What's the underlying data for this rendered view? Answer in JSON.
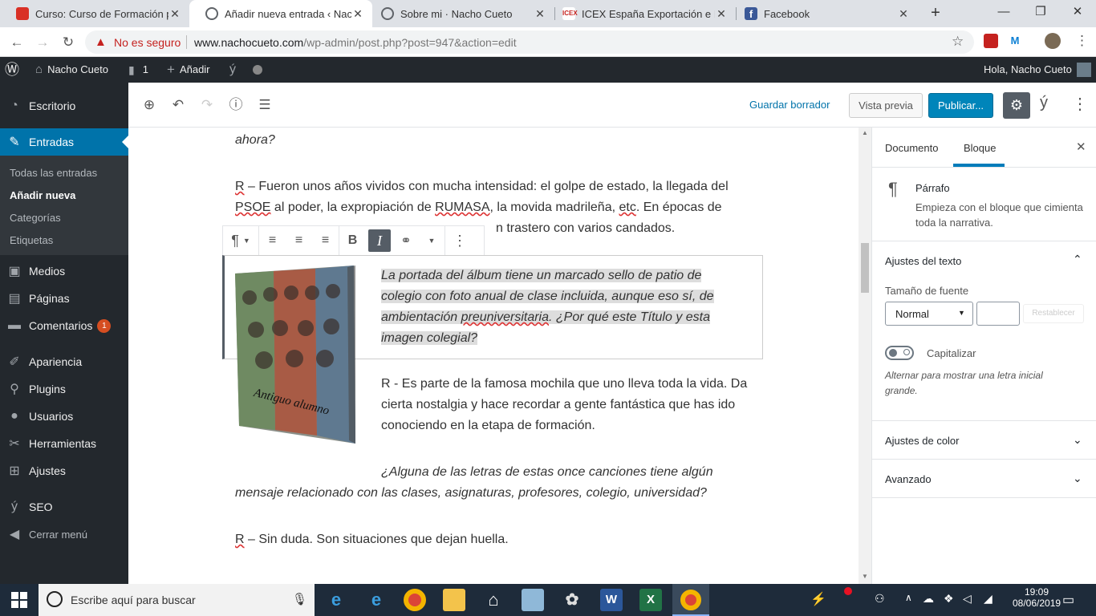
{
  "browser": {
    "tabs": [
      {
        "title": "Curso: Curso de Formación par",
        "favicon_color": "#d93025"
      },
      {
        "title": "Añadir nueva entrada ‹ Nacho",
        "favicon_color": "#5f6368"
      },
      {
        "title": "Sobre mi · Nacho Cueto",
        "favicon_color": "#5f6368"
      },
      {
        "title": "ICEX España Exportación e Inv",
        "favicon_color": "#c5221f"
      },
      {
        "title": "Facebook",
        "favicon_color": "#3b5998"
      }
    ],
    "security_label": "No es seguro",
    "url_host": "www.nachocueto.com",
    "url_path": "/wp-admin/post.php?post=947&action=edit"
  },
  "admin_bar": {
    "site_name": "Nacho Cueto",
    "comments_count": "1",
    "new_label": "Añadir",
    "greeting": "Hola, Nacho Cueto"
  },
  "sidebar": {
    "items": [
      {
        "label": "Escritorio",
        "icon": "dashboard-icon"
      },
      {
        "label": "Entradas",
        "icon": "pin-icon"
      },
      {
        "label": "Medios",
        "icon": "media-icon"
      },
      {
        "label": "Páginas",
        "icon": "pages-icon"
      },
      {
        "label": "Comentarios",
        "icon": "comments-icon",
        "badge": "1"
      },
      {
        "label": "Apariencia",
        "icon": "brush-icon"
      },
      {
        "label": "Plugins",
        "icon": "plugin-icon"
      },
      {
        "label": "Usuarios",
        "icon": "users-icon"
      },
      {
        "label": "Herramientas",
        "icon": "tools-icon"
      },
      {
        "label": "Ajustes",
        "icon": "settings-icon"
      },
      {
        "label": "SEO",
        "icon": "yoast-icon"
      },
      {
        "label": "Cerrar menú",
        "icon": "collapse-icon"
      }
    ],
    "submenu": [
      "Todas las entradas",
      "Añadir nueva",
      "Categorías",
      "Etiquetas"
    ]
  },
  "editor": {
    "save_draft": "Guardar borrador",
    "preview": "Vista previa",
    "publish": "Publicar..."
  },
  "content": {
    "p0": "ahora?",
    "p1_line1_a": "R",
    "p1_line1_b": " – Fueron unos años vividos con mucha intensidad: el golpe de estado, la llegada del",
    "p1_line2_a": "PSOE",
    "p1_line2_b": " al poder, la expropiación de ",
    "p1_line2_c": "RUMASA",
    "p1_line2_d": ", la movida madrileña, ",
    "p1_line2_e": "etc",
    "p1_line2_f": ". En épocas de",
    "p1_line3": "n trastero con varios candados.",
    "selected_line1": "La portada del álbum tiene un marcado sello de patio de",
    "selected_line2": "colegio  con foto anual de clase incluida, aunque eso sí, de",
    "selected_line3_a": "ambientación ",
    "selected_line3_b": "preuniversitaria",
    "selected_line3_c": ". ¿Por qué este Título y esta",
    "selected_line4": "imagen colegial?",
    "p3_line1": "R - Es parte de la famosa mochila que uno lleva toda la vida. Da",
    "p3_line2": "cierta nostalgia y hace recordar a gente fantástica que has ido",
    "p3_line3": "conociendo en la etapa de formación.",
    "p4_line1": "¿Alguna de las letras de estas once canciones tiene algún",
    "p4_line2": "mensaje relacionado con las clases, asignaturas, profesores, colegio, universidad?",
    "p5_a": "R",
    "p5_b": " – Sin duda. Son situaciones que dejan huella.",
    "album_caption": "Antiguo alumno"
  },
  "panel": {
    "tab_document": "Documento",
    "tab_block": "Bloque",
    "block_name": "Párrafo",
    "block_desc_1": "Empieza con el bloque que cimienta",
    "block_desc_2": "toda la narrativa.",
    "text_settings": "Ajustes del texto",
    "font_size_label": "Tamaño de fuente",
    "font_size_value": "Normal",
    "reset": "Restablecer",
    "dropcap_label": "Capitalizar",
    "dropcap_help_1": "Alternar para mostrar una letra inicial",
    "dropcap_help_2": "grande.",
    "color_settings": "Ajustes de color",
    "advanced": "Avanzado"
  },
  "taskbar": {
    "search_placeholder": "Escribe aquí para buscar",
    "time": "19:09",
    "date": "08/06/2019"
  }
}
